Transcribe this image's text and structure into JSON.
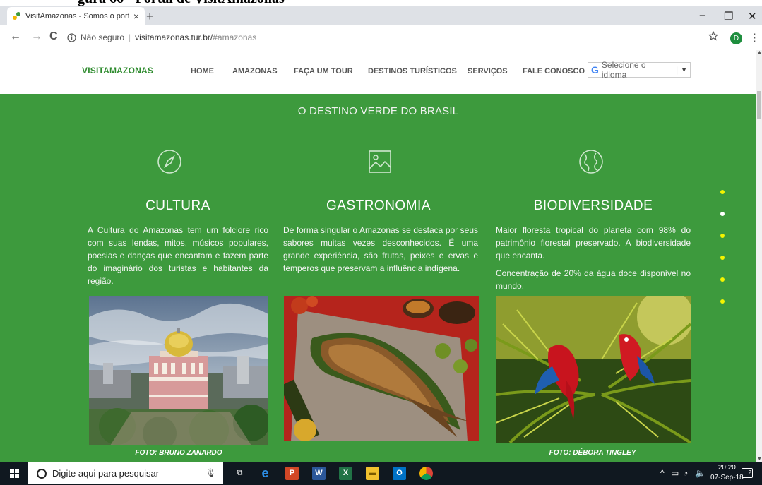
{
  "document_caption": "gura 66 - Portal de VisitAmazonas",
  "browser": {
    "tab_title": "VisitAmazonas - Somos o portal",
    "tab_close": "×",
    "new_tab": "+",
    "window_controls": {
      "minimize": "−",
      "restore": "❐",
      "close": "✕"
    },
    "back": "←",
    "forward": "→",
    "reload": "C",
    "security": "Não seguro",
    "url_host": "visitamazonas.tur.br/",
    "url_fragment": "#amazonas",
    "bookmark_icon": "star-icon",
    "profile_initial": "D",
    "menu": "⋮"
  },
  "site": {
    "logo": "VISITAMAZONAS",
    "nav": [
      "HOME",
      "AMAZONAS",
      "FAÇA UM TOUR",
      "DESTINOS TURÍSTICOS",
      "SERVIÇOS",
      "FALE CONOSCO"
    ],
    "translate": {
      "g": "G",
      "label": "Selecione o idioma",
      "arrow": "▼"
    },
    "headline": "O DESTINO VERDE DO BRASIL",
    "columns": [
      {
        "icon": "compass-icon",
        "title": "CULTURA",
        "text": "A Cultura do Amazonas tem um folclore rico com suas lendas, mitos, músicos populares, poesias e danças que encantam e fazem parte do imaginário dos turistas e habitantes da região.",
        "photo": "teatro-amazonas-photo",
        "credit": "FOTO: BRUNO ZANARDO"
      },
      {
        "icon": "image-icon",
        "title": "GASTRONOMIA",
        "text": "De forma singular o Amazonas se destaca por seus sabores muitas vezes desconhecidos. É uma grande experiência, são frutas, peixes e ervas e temperos que preservam a influência indígena.",
        "photo": "grilled-fish-photo",
        "credit": ""
      },
      {
        "icon": "globe-icon",
        "title": "BIODIVERSIDADE",
        "text": "Maior floresta tropical do planeta com 98% do patrimônio florestal preservado. A biodiversidade que encanta.",
        "text2": "Concentração de 20% da água doce disponível no mundo.",
        "photo": "macaws-photo",
        "credit": "FOTO: DÉBORA TINGLEY"
      }
    ],
    "dot_count": 6,
    "colors": {
      "green": "#3d9a3d",
      "logo_green": "#2e8b2e",
      "dot_yellow": "#f4f400",
      "dot_white": "#ffffff"
    }
  },
  "taskbar": {
    "search_placeholder": "Digite aqui para pesquisar",
    "apps": [
      "task-view-icon",
      "edge-icon",
      "powerpoint-icon",
      "word-icon",
      "excel-icon",
      "file-explorer-icon",
      "outlook-icon",
      "chrome-icon"
    ],
    "tray": "^",
    "time": "20:20",
    "date": "07-Sep-18",
    "notification_count": "2"
  }
}
